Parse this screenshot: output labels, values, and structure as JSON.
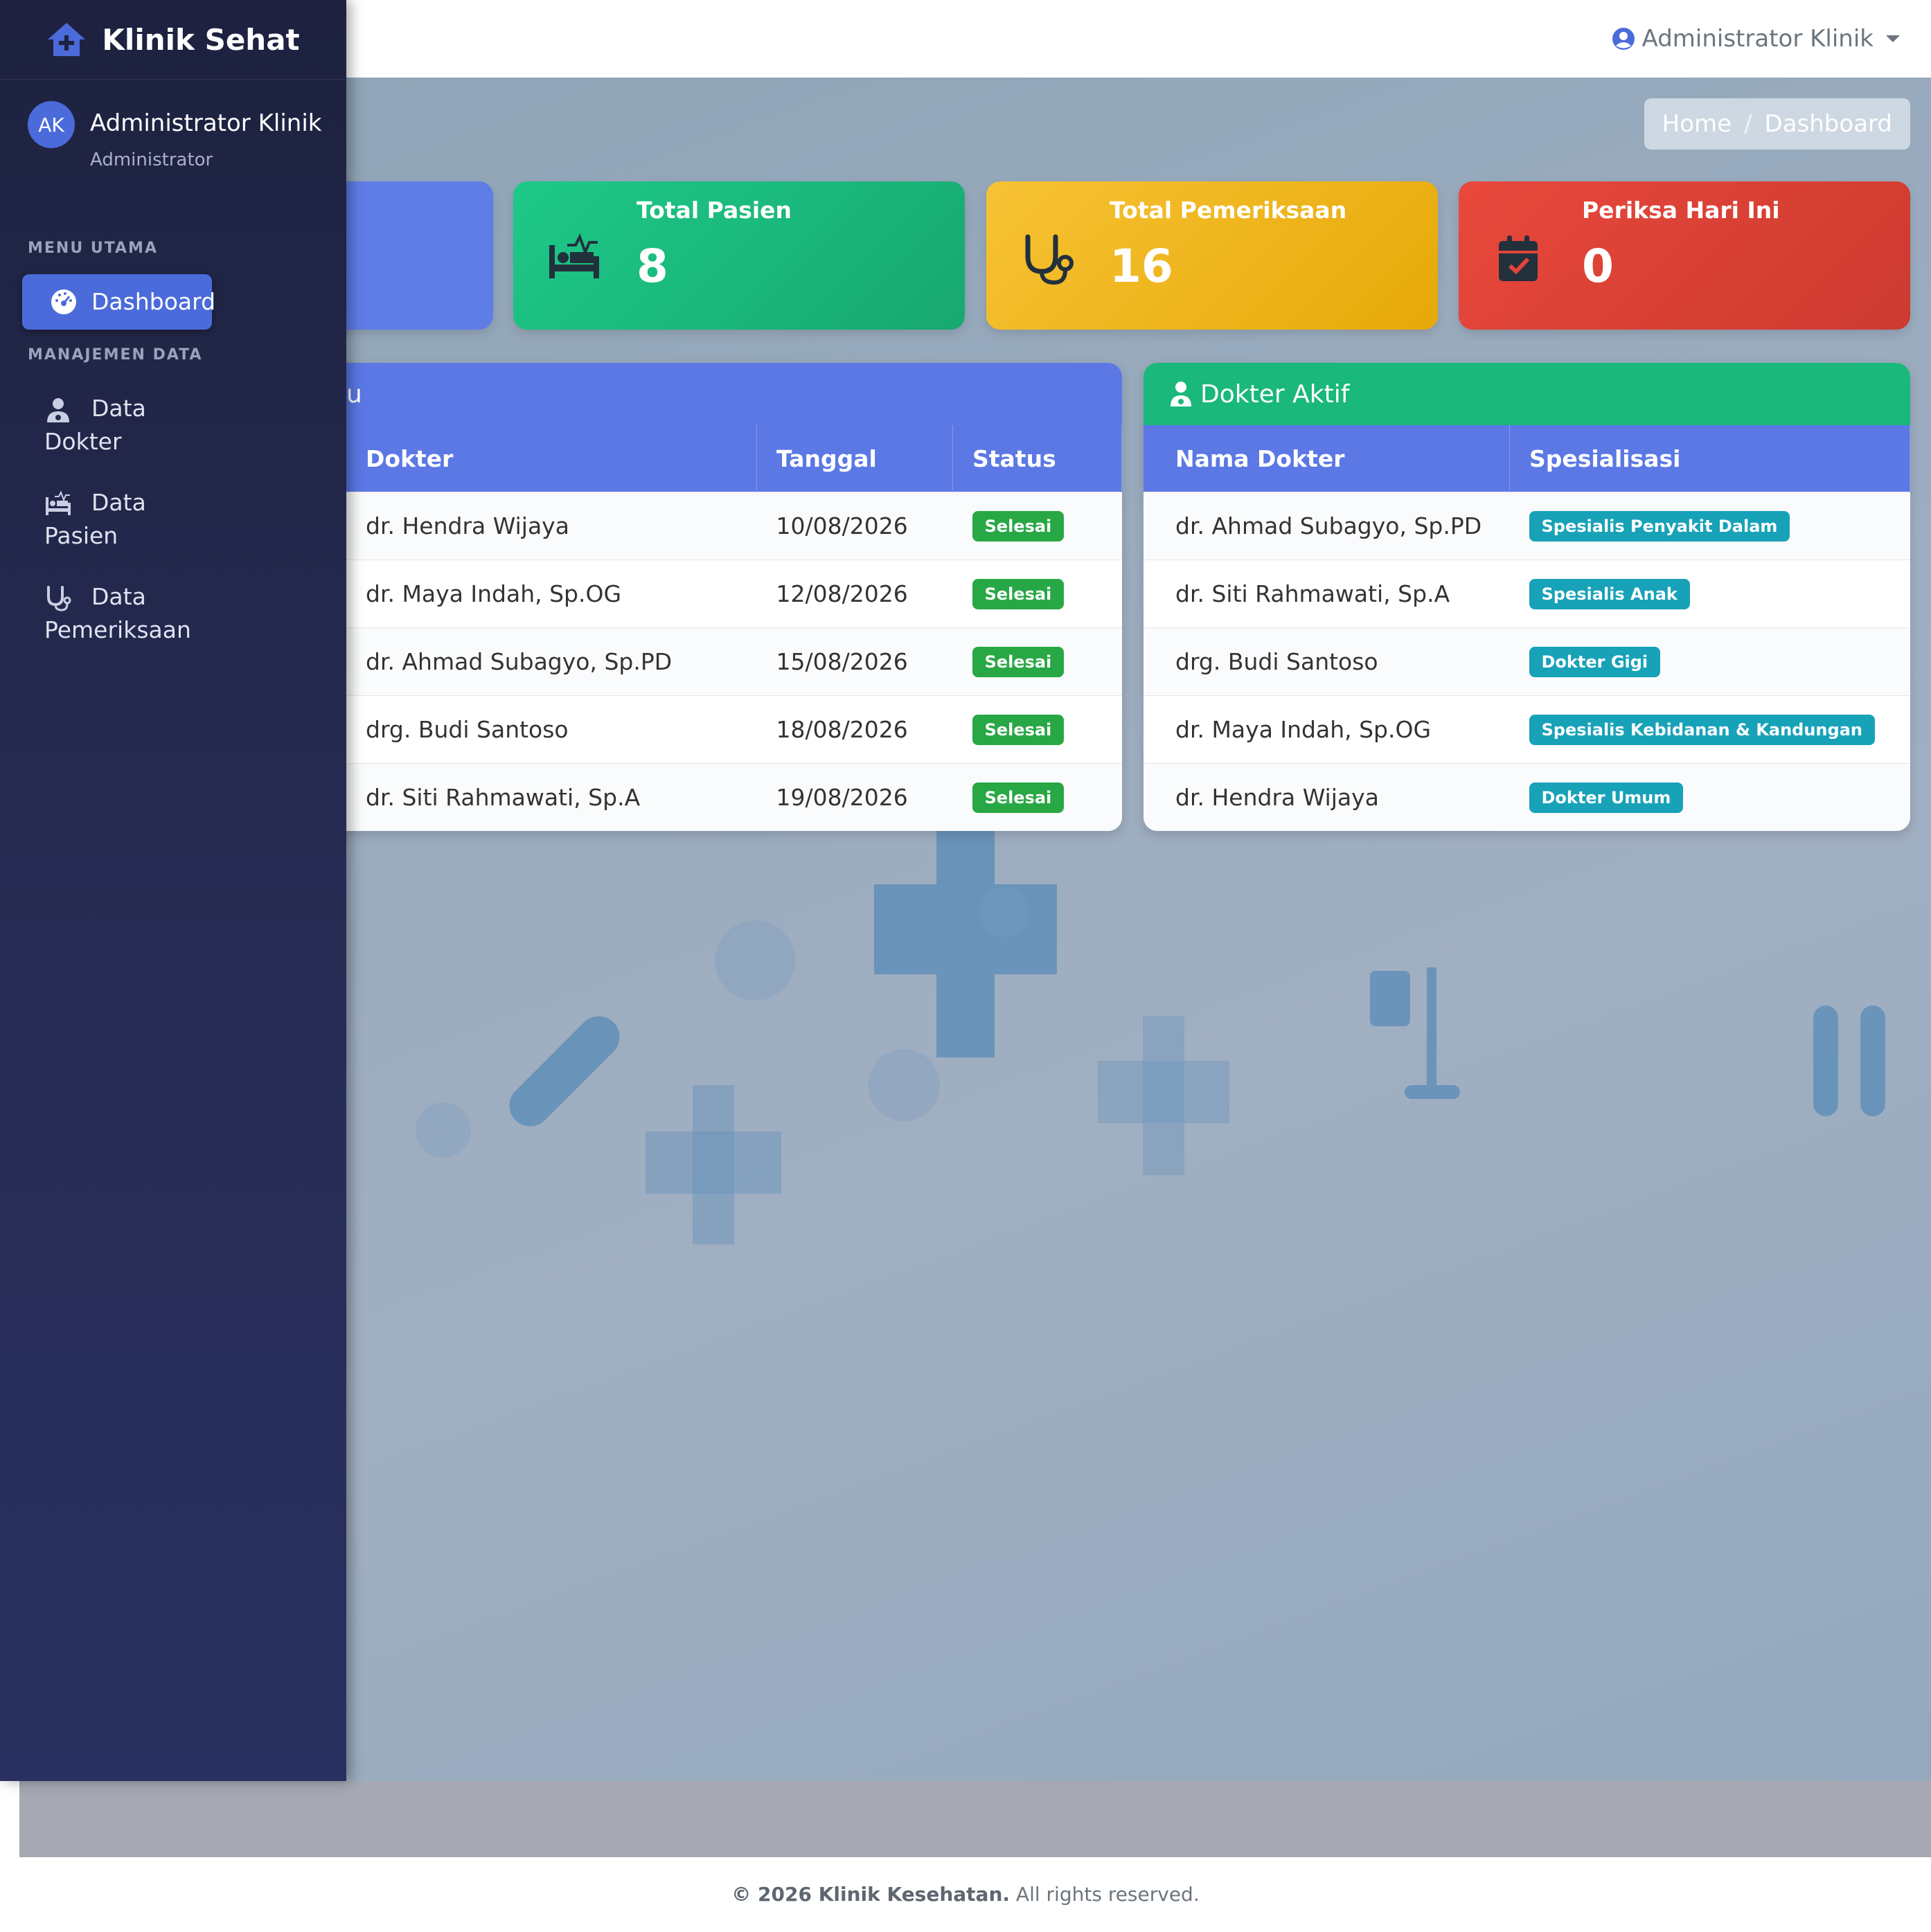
{
  "brand": {
    "name": "Klinik Sehat"
  },
  "user": {
    "initials": "AK",
    "name": "Administrator Klinik",
    "role": "Administrator"
  },
  "menu": {
    "header_main": "MENU UTAMA",
    "header_data": "MANAJEMEN DATA",
    "dashboard": "Dashboard",
    "dokter_1": "Data",
    "dokter_2": "Dokter",
    "pasien_1": "Data",
    "pasien_2": "Pasien",
    "periksa_1": "Data",
    "periksa_2": "Pemeriksaan"
  },
  "navbar": {
    "user": "Administrator Klinik"
  },
  "breadcrumb": {
    "home": "Home",
    "sep": "/",
    "current": "Dashboard"
  },
  "stats": [
    {
      "title": "Total Pasien",
      "value": "8",
      "color": "#1ab87a",
      "icon": "patient-bed-icon"
    },
    {
      "title": "Total Pemeriksaan",
      "value": "16",
      "color": "#f2b418",
      "icon": "stethoscope-icon"
    },
    {
      "title": "Periksa Hari Ini",
      "value": "0",
      "color": "#e3443a",
      "icon": "calendar-check-icon"
    }
  ],
  "left_panel": {
    "title_fragment": "u",
    "headers": [
      "Dokter",
      "Tanggal",
      "Status"
    ],
    "rows": [
      [
        "dr. Hendra Wijaya",
        "10/08/2026",
        "Selesai"
      ],
      [
        "dr. Maya Indah, Sp.OG",
        "12/08/2026",
        "Selesai"
      ],
      [
        "dr. Ahmad Subagyo, Sp.PD",
        "15/08/2026",
        "Selesai"
      ],
      [
        "drg. Budi Santoso",
        "18/08/2026",
        "Selesai"
      ],
      [
        "dr. Siti Rahmawati, Sp.A",
        "19/08/2026",
        "Selesai"
      ]
    ]
  },
  "right_panel": {
    "title": "Dokter Aktif",
    "headers": [
      "Nama Dokter",
      "Spesialisasi"
    ],
    "rows": [
      [
        "dr. Ahmad Subagyo, Sp.PD",
        "Spesialis Penyakit Dalam"
      ],
      [
        "dr. Siti Rahmawati, Sp.A",
        "Spesialis Anak"
      ],
      [
        "drg. Budi Santoso",
        "Dokter Gigi"
      ],
      [
        "dr. Maya Indah, Sp.OG",
        "Spesialis Kebidanan & Kandungan"
      ],
      [
        "dr. Hendra Wijaya",
        "Dokter Umum"
      ]
    ]
  },
  "footer": {
    "brand": "© 2026 Klinik Kesehatan.",
    "rest": "All rights reserved."
  },
  "colors": {
    "primary": "#4b6bdb",
    "success": "#28a745",
    "info": "#17a2b8",
    "sidebar": "#1e2240"
  }
}
